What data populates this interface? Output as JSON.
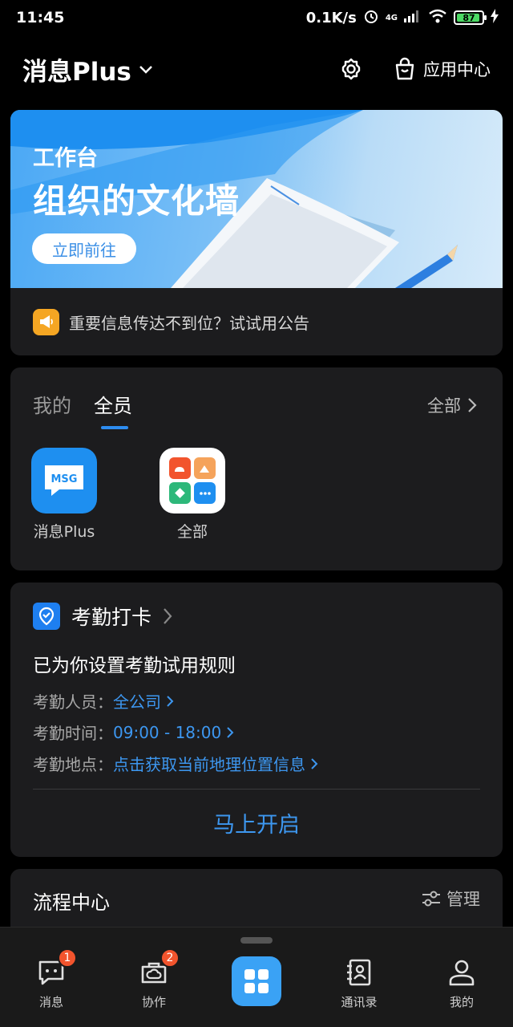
{
  "status_bar": {
    "time": "11:45",
    "net_speed": "0.1K/s",
    "network": "4G",
    "battery": "87"
  },
  "header": {
    "title": "消息Plus",
    "app_center": "应用中心"
  },
  "banner": {
    "subtitle": "工作台",
    "headline": "组织的文化墙",
    "button": "立即前往"
  },
  "notice": {
    "text": "重要信息传达不到位？试试用公告"
  },
  "apps_panel": {
    "tabs": [
      "我的",
      "全员"
    ],
    "active_tab": "全员",
    "see_all": "全部",
    "apps": [
      {
        "label": "消息Plus",
        "icon_text": "MSG"
      },
      {
        "label": "全部"
      }
    ]
  },
  "attendance": {
    "title": "考勤打卡",
    "rule": "已为你设置考勤试用规则",
    "rows": [
      {
        "label": "考勤人员：",
        "value": "全公司"
      },
      {
        "label": "考勤时间：",
        "value": "09:00 - 18:00"
      },
      {
        "label": "考勤地点：",
        "value": "点击获取当前地理位置信息"
      }
    ],
    "action": "马上开启"
  },
  "flow_center": {
    "title": "流程中心",
    "manage": "管理"
  },
  "bottom_nav": {
    "items": [
      {
        "label": "消息",
        "badge": "1"
      },
      {
        "label": "协作",
        "badge": "2"
      },
      {
        "label": "通讯录"
      },
      {
        "label": "我的"
      }
    ]
  },
  "colors": {
    "accent": "#3d97f0",
    "badge": "#f2542d",
    "notice": "#f5a623"
  }
}
